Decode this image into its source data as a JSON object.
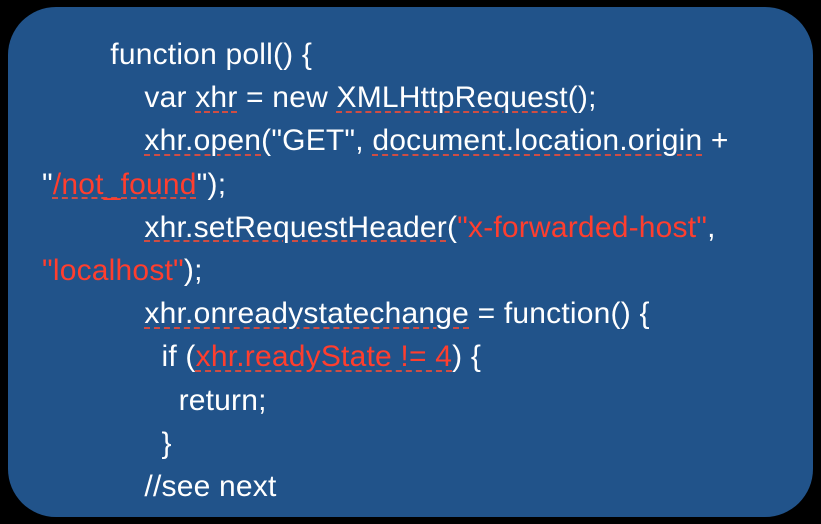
{
  "code": {
    "line1": {
      "indent": "        ",
      "t1": "function poll() {"
    },
    "line2": {
      "indent": "            ",
      "t1": "var ",
      "t2": "xhr",
      "t3": " = new ",
      "t4": "XMLHttpRequest",
      "t5": "();"
    },
    "line3": {
      "indent": "            ",
      "t1": "xhr.open",
      "t2": "(\"GET\", ",
      "t3": "document.location.origin",
      "t4": " + \"",
      "t5": "/not_found",
      "t6": "\");"
    },
    "line4": {
      "indent": "            ",
      "t1": "xhr.setRequestHeader",
      "t2": "(",
      "t3": "\"x-forwarded-host\"",
      "t4": ", ",
      "t5": "\"localhost\"",
      "t6": ");"
    },
    "line5": {
      "indent": "            ",
      "t1": "xhr.onreadystatechange",
      "t2": " = function() {"
    },
    "line6": {
      "indent": "              ",
      "t1": "if (",
      "t2": "xhr.readyState != 4",
      "t3": ") {"
    },
    "line7": {
      "indent": "                ",
      "t1": "return;"
    },
    "line8": {
      "indent": "              ",
      "t1": "}"
    },
    "line9": {
      "indent": "            ",
      "t1": "//see next"
    }
  }
}
